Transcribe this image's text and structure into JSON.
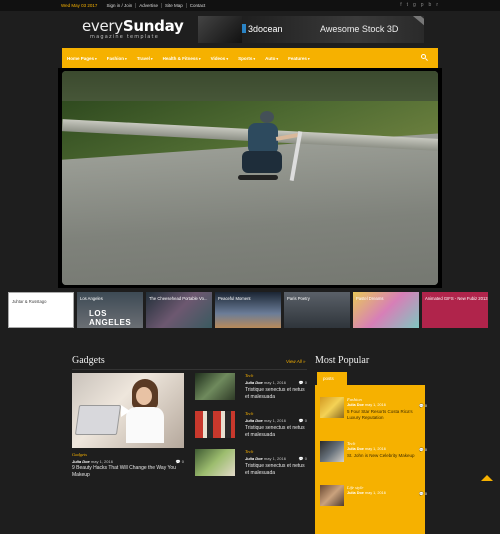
{
  "topbar": {
    "date": "Wed May 03 2017",
    "links": [
      "Sign in / Join",
      "Advertise",
      "Site Map",
      "Contact"
    ],
    "social_icons": [
      "facebook-icon",
      "twitter-icon",
      "google-plus-icon",
      "pinterest-icon",
      "behance-icon",
      "rss-icon"
    ]
  },
  "logo": {
    "light": "every",
    "bold": "Sunday",
    "tagline": "magazine template"
  },
  "banner": {
    "brand": "3docean",
    "tagline": "Awesome Stock 3D"
  },
  "nav": {
    "items": [
      {
        "label": "Home Pages",
        "dropdown": true
      },
      {
        "label": "Fashion",
        "dropdown": true
      },
      {
        "label": "Travel",
        "dropdown": true
      },
      {
        "label": "Health & Fitness",
        "dropdown": true
      },
      {
        "label": "Videos",
        "dropdown": true
      },
      {
        "label": "Sports",
        "dropdown": true
      },
      {
        "label": "Auto",
        "dropdown": true
      },
      {
        "label": "Features",
        "dropdown": true
      }
    ],
    "chevron": "▾",
    "accent": "#f6b100"
  },
  "strip": [
    {
      "label": "Juhtar & Russtago"
    },
    {
      "label": "Los Angeles",
      "big": "LOS ANGELES"
    },
    {
      "label": "The Cheesehead Portable Vo..."
    },
    {
      "label": "Peaceful Moment"
    },
    {
      "label": "Paris Poetry"
    },
    {
      "label": "Pastel Dreams"
    },
    {
      "label": "Animated GIFS - New Fubiz 2013"
    }
  ],
  "gadgets": {
    "title": "Gadgets",
    "view_all": "View All »",
    "feature": {
      "category": "Gadgets",
      "author": "Julia Doe",
      "date": "may 1, 2016",
      "comments": "0",
      "headline": "9 Beauty Hacks That Will Change the Way You Makeup"
    },
    "side": [
      {
        "category": "Tech",
        "author": "Julia Doe",
        "date": "may 1, 2016",
        "comments": "0",
        "headline": "Tristique senectus et netus et malesuada"
      },
      {
        "category": "Tech",
        "author": "Julia Doe",
        "date": "may 1, 2016",
        "comments": "0",
        "headline": "Tristique senectus et netus et malesuada"
      },
      {
        "category": "Tech",
        "author": "Julia Doe",
        "date": "may 1, 2016",
        "comments": "0",
        "headline": "Tristique senectus et netus et malesuada"
      }
    ]
  },
  "popular": {
    "title": "Most Popular",
    "tab": "posts",
    "items": [
      {
        "category": "Fashion",
        "author": "Julia Doe",
        "date": "may 1, 2016",
        "comments": "0",
        "headline": "5 Four Star Resorts Costa Rica's Luxury Reputation"
      },
      {
        "category": "Tech",
        "author": "Julia Doe",
        "date": "may 1, 2016",
        "comments": "0",
        "headline": "St. John is New Celebrity Makeup"
      },
      {
        "category": "Life style",
        "author": "Julia Doe",
        "date": "may 1, 2016",
        "comments": "0",
        "headline": ""
      }
    ]
  },
  "comment_glyph": "💬"
}
